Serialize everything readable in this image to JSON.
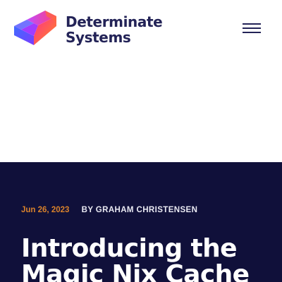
{
  "header": {
    "logo": {
      "line1": "Determinate",
      "line2": "Systems"
    },
    "menu_icon": "hamburger-menu-icon"
  },
  "article": {
    "date": "Jun 26, 2023",
    "byline": "BY GRAHAM CHRISTENSEN",
    "title_line1": "Introducing the",
    "title_line2": "Magic Nix Cache"
  },
  "colors": {
    "brand_text": "#232357",
    "hero_background": "#10103a",
    "date_accent": "#d9822b",
    "title_text": "#ffffff"
  }
}
